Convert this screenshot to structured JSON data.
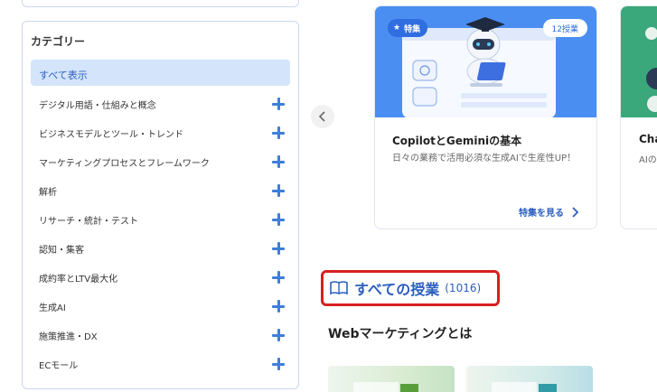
{
  "sidebar": {
    "title": "カテゴリー",
    "selected": "すべて表示",
    "items": [
      "デジタル用語・仕組みと概念",
      "ビジネスモデルとツール・トレンド",
      "マーケティングプロセスとフレームワーク",
      "解析",
      "リサーチ・統計・テスト",
      "認知・集客",
      "成約率とLTV最大化",
      "生成AI",
      "施策推進・DX",
      "ECモール"
    ]
  },
  "carousel": {
    "card1": {
      "badge": "特集",
      "count": "12授業",
      "title": "CopilotとGeminiの基本",
      "description": "日々の業務で活用必須な生成AIで生産性UP！",
      "link": "特集を見る"
    },
    "card2": {
      "title": "Cha",
      "description": "AIの"
    }
  },
  "all_lessons": {
    "title": "すべての授業",
    "count": "(1016)"
  },
  "section": {
    "title": "Webマーケティングとは"
  },
  "colors": {
    "accent": "#2a5fc0",
    "plus": "#3d7fd9",
    "highlight_border": "#d62020",
    "hero_blue": "#4a8ef2",
    "hero_green": "#3aa87a"
  }
}
